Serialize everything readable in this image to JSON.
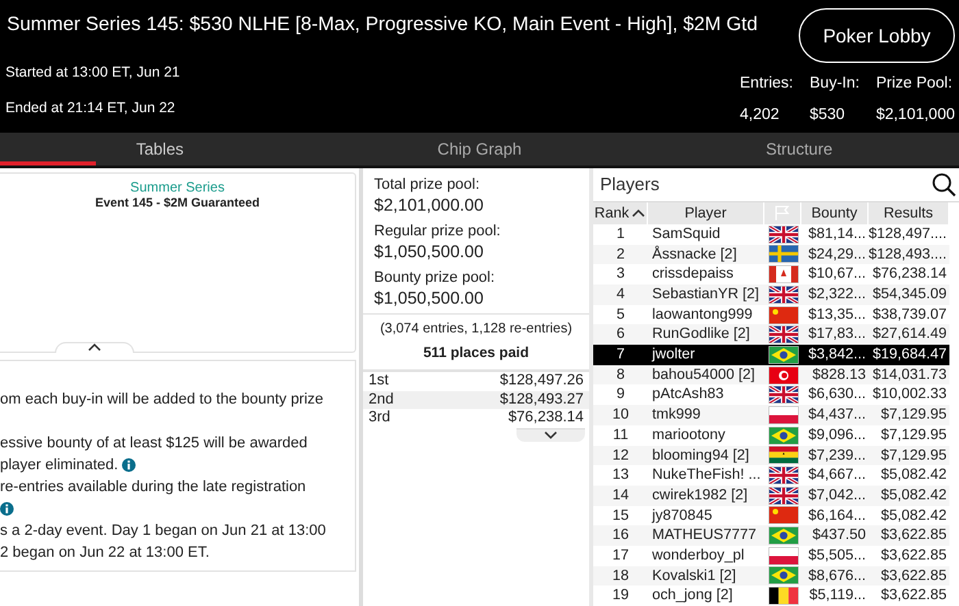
{
  "header": {
    "title": "Summer Series 145: $530 NLHE [8-Max, Progressive KO, Main Event - High], $2M Gtd",
    "lobby_button": "Poker Lobby",
    "started": "Started at 13:00 ET, Jun 21",
    "ended": "Ended at 21:14 ET, Jun 22",
    "stats": [
      {
        "label": "Entries:",
        "value": "4,202"
      },
      {
        "label": "Buy-In:",
        "value": "$530"
      },
      {
        "label": "Prize Pool:",
        "value": "$2,101,000"
      }
    ]
  },
  "tabs": [
    {
      "label": "Tables",
      "selected": true
    },
    {
      "label": "Chip Graph",
      "selected": false
    },
    {
      "label": "Structure",
      "selected": false
    }
  ],
  "event_card": {
    "series": "Summer Series",
    "event": "Event 145 - $2M Guaranteed"
  },
  "details": [
    {
      "text": "om each buy-in will be added to the bounty prize",
      "info": false
    },
    {
      "info": false
    },
    {
      "text": "essive bounty of at least $125 will be awarded",
      "info": false
    },
    {
      "text": " player eliminated.",
      "info": true
    },
    {
      "text": "re-entries available during the late registration",
      "info": false
    },
    {
      "info": true
    },
    {
      "text": "s a 2-day event. Day 1 began on Jun 21 at 13:00",
      "info": false
    },
    {
      "text": "2 began on Jun 22 at 13:00 ET.",
      "info": false
    }
  ],
  "prize_pools": [
    {
      "label": "Total prize pool:",
      "value": "$2,101,000.00"
    },
    {
      "label": "Regular prize pool:",
      "value": "$1,050,500.00"
    },
    {
      "label": "Bounty prize pool:",
      "value": "$1,050,500.00"
    }
  ],
  "entries_note": "(3,074 entries, 1,128 re-entries)",
  "places_paid": "511 places paid",
  "payouts": [
    {
      "place": "1st",
      "amount": "$128,497.26"
    },
    {
      "place": "2nd",
      "amount": "$128,493.27"
    },
    {
      "place": "3rd",
      "amount": "$76,238.14"
    }
  ],
  "players": {
    "title": "Players",
    "columns": [
      "Rank",
      "Player",
      "Bounty",
      "Results"
    ],
    "rows": [
      {
        "rank": "1",
        "player": "SamSquid",
        "kind": "gb",
        "bounty": "$81,14...",
        "results": "$128,497....",
        "selected": false
      },
      {
        "rank": "2",
        "player": "Åssnacke [2]",
        "kind": "se",
        "bounty": "$24,29...",
        "results": "$128,493....",
        "selected": false
      },
      {
        "rank": "3",
        "player": "crissdepaiss",
        "kind": "ca",
        "bounty": "$10,67...",
        "results": "$76,238.14",
        "selected": false
      },
      {
        "rank": "4",
        "player": "SebastianYR [2]",
        "kind": "gb",
        "bounty": "$2,322...",
        "results": "$54,345.09",
        "selected": false
      },
      {
        "rank": "5",
        "player": "laowantong999",
        "kind": "cn",
        "bounty": "$13,35...",
        "results": "$38,739.07",
        "selected": false
      },
      {
        "rank": "6",
        "player": "RunGodlike [2]",
        "kind": "gb",
        "bounty": "$17,83...",
        "results": "$27,614.49",
        "selected": false
      },
      {
        "rank": "7",
        "player": "jwolter",
        "kind": "br",
        "bounty": "$3,842...",
        "results": "$19,684.47",
        "selected": true
      },
      {
        "rank": "8",
        "player": "bahou54000 [2]",
        "kind": "tn",
        "bounty": "$828.13",
        "results": "$14,031.73",
        "selected": false
      },
      {
        "rank": "9",
        "player": "pAtcAsh83",
        "kind": "gb",
        "bounty": "$6,630...",
        "results": "$10,002.33",
        "selected": false
      },
      {
        "rank": "10",
        "player": "tmk999",
        "kind": "pl",
        "bounty": "$4,437...",
        "results": "$7,129.95",
        "selected": false
      },
      {
        "rank": "11",
        "player": "mariootony",
        "kind": "br",
        "bounty": "$9,096...",
        "results": "$7,129.95",
        "selected": false
      },
      {
        "rank": "12",
        "player": "blooming94 [2]",
        "kind": "gh",
        "bounty": "$7,239...",
        "results": "$7,129.95",
        "selected": false
      },
      {
        "rank": "13",
        "player": "NukeTheFish! ...",
        "kind": "gb",
        "bounty": "$4,667...",
        "results": "$5,082.42",
        "selected": false
      },
      {
        "rank": "14",
        "player": "cwirek1982 [2]",
        "kind": "gb",
        "bounty": "$7,042...",
        "results": "$5,082.42",
        "selected": false
      },
      {
        "rank": "15",
        "player": "jy870845",
        "kind": "cn",
        "bounty": "$6,164...",
        "results": "$5,082.42",
        "selected": false
      },
      {
        "rank": "16",
        "player": "MATHEUS7777",
        "kind": "br",
        "bounty": "$437.50",
        "results": "$3,622.85",
        "selected": false
      },
      {
        "rank": "17",
        "player": "wonderboy_pl",
        "kind": "pl",
        "bounty": "$5,505...",
        "results": "$3,622.85",
        "selected": false
      },
      {
        "rank": "18",
        "player": "Kovalski1 [2]",
        "kind": "br",
        "bounty": "$8,676...",
        "results": "$3,622.85",
        "selected": false
      },
      {
        "rank": "19",
        "player": "och_jong [2]",
        "kind": "be",
        "bounty": "$5,119...",
        "results": "$3,622.85",
        "selected": false
      }
    ]
  }
}
